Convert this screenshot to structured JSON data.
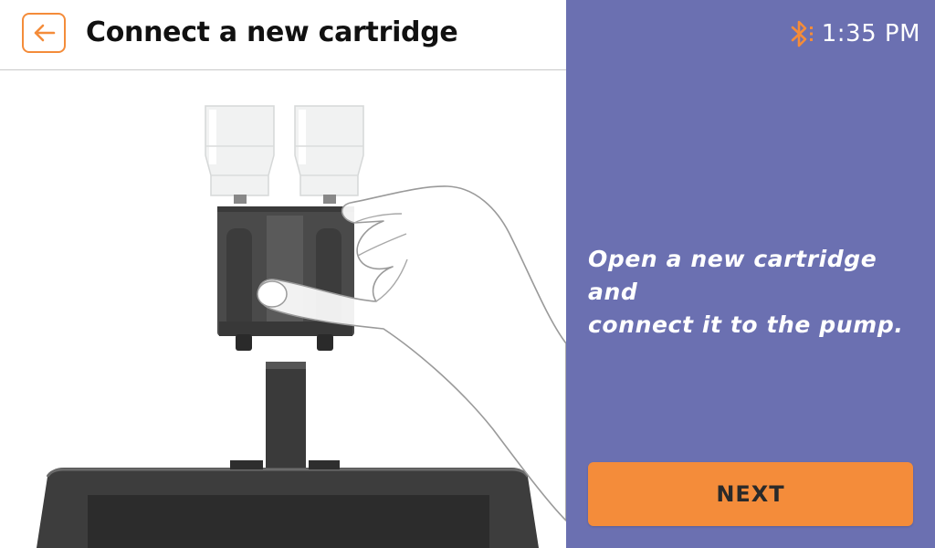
{
  "header": {
    "title": "Connect a new cartridge",
    "back_icon": "arrow-left-icon"
  },
  "status_bar": {
    "bluetooth_icon": "bluetooth-icon",
    "time": "1:35 PM"
  },
  "instruction": {
    "line1": "Open a new cartridge and",
    "line2": "connect it to the pump."
  },
  "actions": {
    "next_label": "NEXT"
  },
  "colors": {
    "accent": "#f48c3a",
    "panel": "#6b70b1"
  }
}
